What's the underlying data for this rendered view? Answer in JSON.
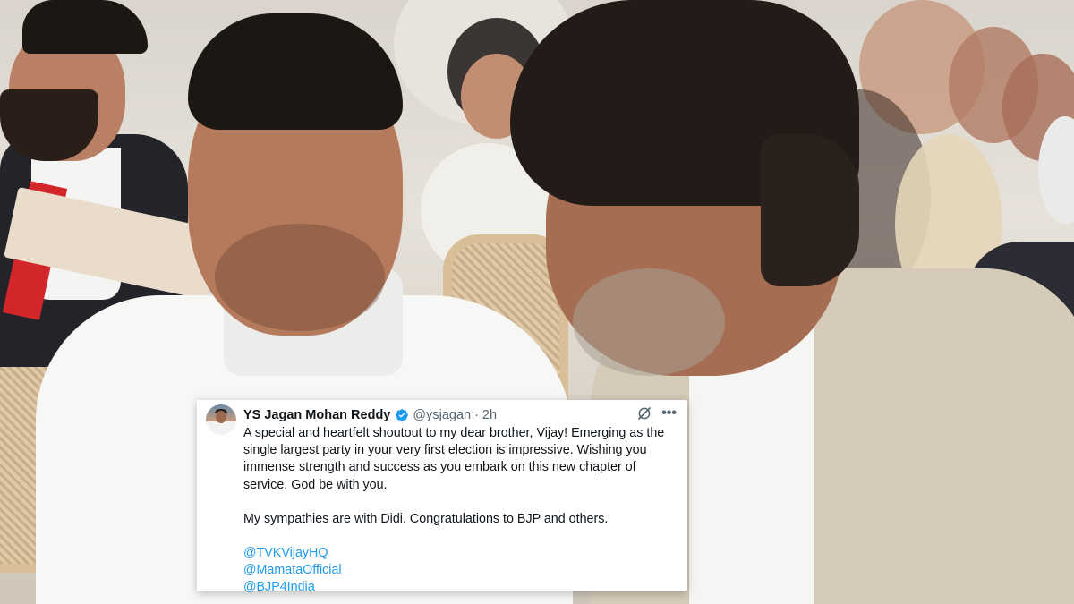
{
  "tweet": {
    "author_name": "YS Jagan Mohan Reddy",
    "handle": "@ysjagan",
    "separator": "·",
    "time": "2h",
    "verified_icon": "verified-badge-icon",
    "paragraphs": [
      "A special and heartfelt shoutout to my dear brother, Vijay! Emerging as the single largest party in your very first election is impressive. Wishing you immense strength and success as you embark on this new chapter of service. God be with you.",
      "My sympathies are with Didi. Congratulations to BJP and others."
    ],
    "mentions": [
      "@TVKVijayHQ",
      "@MamataOfficial",
      "@BJP4India"
    ],
    "more_label": "•••"
  },
  "colors": {
    "link": "#1d9bf0",
    "text": "#0f1419",
    "secondary": "#536471",
    "card_bg": "#ffffff"
  }
}
